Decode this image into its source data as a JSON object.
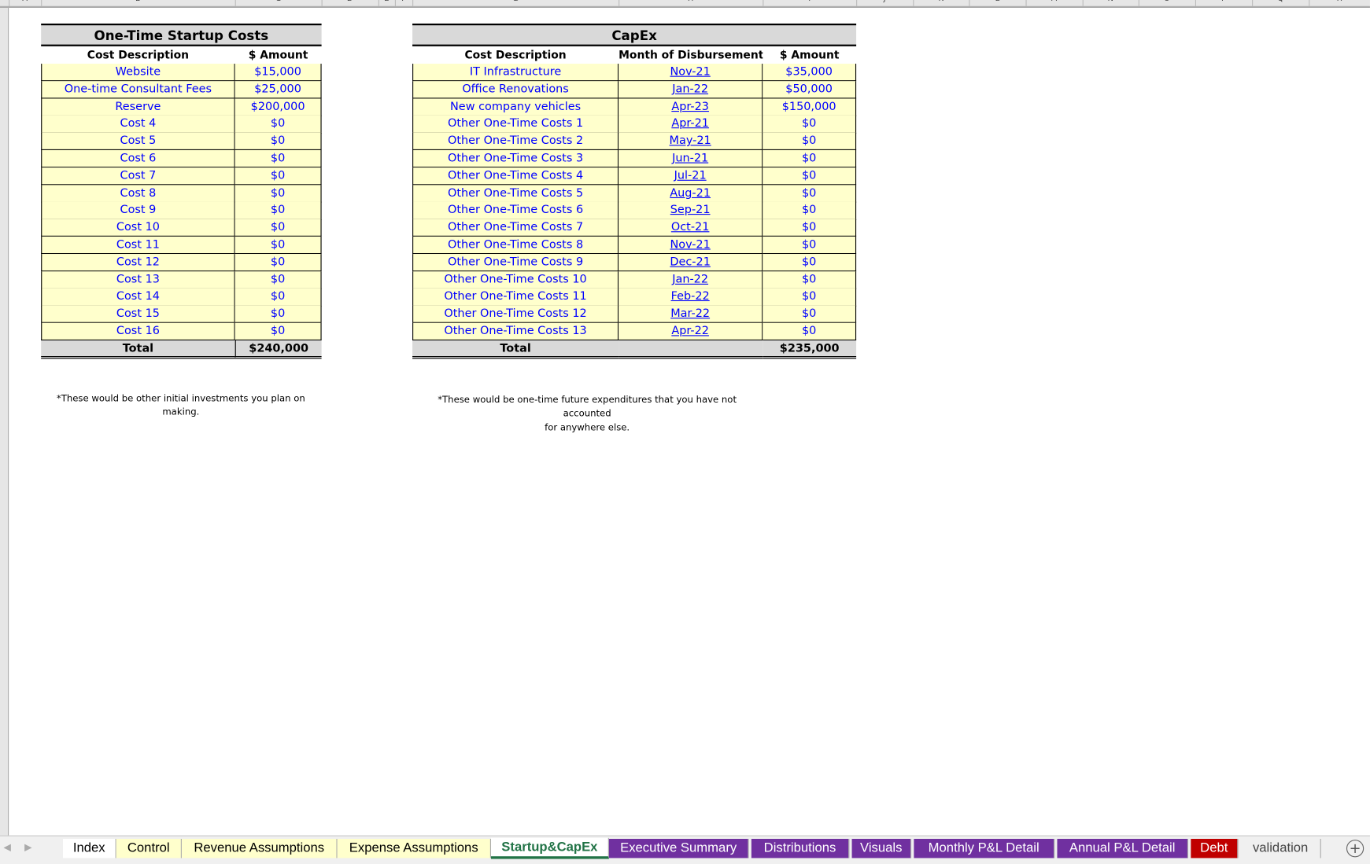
{
  "columns": [
    "A",
    "B",
    "C",
    "D",
    "E",
    "F",
    "G",
    "H",
    "I",
    "J",
    "K",
    "L",
    "M",
    "N",
    "O",
    "P",
    "Q",
    "R"
  ],
  "startup": {
    "title": "One-Time Startup Costs",
    "headers": [
      "Cost Description",
      "$ Amount"
    ],
    "rows": [
      [
        "Website",
        "$15,000"
      ],
      [
        "One-time Consultant Fees",
        "$25,000"
      ],
      [
        "Reserve",
        "$200,000"
      ],
      [
        "Cost 4",
        "$0"
      ],
      [
        "Cost 5",
        "$0"
      ],
      [
        "Cost 6",
        "$0"
      ],
      [
        "Cost 7",
        "$0"
      ],
      [
        "Cost 8",
        "$0"
      ],
      [
        "Cost 9",
        "$0"
      ],
      [
        "Cost 10",
        "$0"
      ],
      [
        "Cost 11",
        "$0"
      ],
      [
        "Cost 12",
        "$0"
      ],
      [
        "Cost 13",
        "$0"
      ],
      [
        "Cost 14",
        "$0"
      ],
      [
        "Cost 15",
        "$0"
      ],
      [
        "Cost 16",
        "$0"
      ]
    ],
    "total_label": "Total",
    "total": "$240,000",
    "note": "*These would be other initial investments you plan on making."
  },
  "capex": {
    "title": "CapEx",
    "headers": [
      "Cost Description",
      "Month of Disbursement",
      "$ Amount"
    ],
    "rows": [
      [
        "IT Infrastructure",
        "Nov-21",
        "$35,000"
      ],
      [
        "Office Renovations",
        "Jan-22",
        "$50,000"
      ],
      [
        "New company vehicles",
        "Apr-23",
        "$150,000"
      ],
      [
        "Other One-Time Costs 1",
        "Apr-21",
        "$0"
      ],
      [
        "Other One-Time Costs 2",
        "May-21",
        "$0"
      ],
      [
        "Other One-Time Costs 3",
        "Jun-21",
        "$0"
      ],
      [
        "Other One-Time Costs 4",
        "Jul-21",
        "$0"
      ],
      [
        "Other One-Time Costs 5",
        "Aug-21",
        "$0"
      ],
      [
        "Other One-Time Costs 6",
        "Sep-21",
        "$0"
      ],
      [
        "Other One-Time Costs 7",
        "Oct-21",
        "$0"
      ],
      [
        "Other One-Time Costs 8",
        "Nov-21",
        "$0"
      ],
      [
        "Other One-Time Costs 9",
        "Dec-21",
        "$0"
      ],
      [
        "Other One-Time Costs 10",
        "Jan-22",
        "$0"
      ],
      [
        "Other One-Time Costs 11",
        "Feb-22",
        "$0"
      ],
      [
        "Other One-Time Costs 12",
        "Mar-22",
        "$0"
      ],
      [
        "Other One-Time Costs 13",
        "Apr-22",
        "$0"
      ]
    ],
    "total_label": "Total",
    "total": "$235,000",
    "note_line1": "*These would be one-time future expenditures that you have not accounted",
    "note_line2": "for anywhere else."
  },
  "tabs": [
    {
      "label": "Index",
      "bg": "#ffffff",
      "fg": "#000000"
    },
    {
      "label": "Control",
      "bg": "#ffffcc",
      "fg": "#000000"
    },
    {
      "label": "Revenue Assumptions",
      "bg": "#ffffcc",
      "fg": "#000000"
    },
    {
      "label": "Expense Assumptions",
      "bg": "#ffffcc",
      "fg": "#000000"
    },
    {
      "label": "Startup&CapEx",
      "bg": "#ffffff",
      "fg": "#217346",
      "active": true
    },
    {
      "label": "Executive Summary",
      "bg": "#7030a0",
      "fg": "#ffffff"
    },
    {
      "label": "Distributions",
      "bg": "#7030a0",
      "fg": "#ffffff"
    },
    {
      "label": "Visuals",
      "bg": "#7030a0",
      "fg": "#ffffff"
    },
    {
      "label": "Monthly P&L Detail",
      "bg": "#7030a0",
      "fg": "#ffffff"
    },
    {
      "label": "Annual P&L Detail",
      "bg": "#7030a0",
      "fg": "#ffffff"
    },
    {
      "label": "Debt",
      "bg": "#c00000",
      "fg": "#ffffff"
    },
    {
      "label": "validation",
      "bg": "#f0f0f0",
      "fg": "#444444"
    }
  ],
  "add_sheet_icon": "plus-circle-icon"
}
